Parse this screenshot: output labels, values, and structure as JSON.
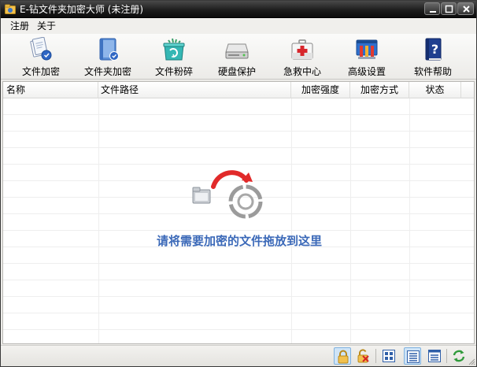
{
  "window": {
    "title": "E-钻文件夹加密大师 (未注册)"
  },
  "menu": {
    "items": [
      {
        "label": "注册"
      },
      {
        "label": "关于"
      }
    ]
  },
  "toolbar": {
    "items": [
      {
        "label": "文件加密",
        "icon": "file-encrypt-icon"
      },
      {
        "label": "文件夹加密",
        "icon": "folder-encrypt-icon"
      },
      {
        "label": "文件粉碎",
        "icon": "file-shred-icon"
      },
      {
        "label": "硬盘保护",
        "icon": "disk-protect-icon"
      },
      {
        "label": "急救中心",
        "icon": "first-aid-icon"
      },
      {
        "label": "高级设置",
        "icon": "advanced-settings-icon"
      },
      {
        "label": "软件帮助",
        "icon": "help-book-icon"
      }
    ]
  },
  "list": {
    "columns": [
      {
        "label": "名称"
      },
      {
        "label": "文件路径"
      },
      {
        "label": "加密强度"
      },
      {
        "label": "加密方式"
      },
      {
        "label": "状态"
      }
    ],
    "empty_hint": "请将需要加密的文件拖放到这里"
  },
  "statusbar": {
    "buttons": [
      {
        "icon": "lock-icon",
        "active": true
      },
      {
        "icon": "unlock-icon",
        "active": false
      },
      {
        "icon": "large-icons-view-icon",
        "active": false
      },
      {
        "icon": "details-view-icon",
        "active": true
      },
      {
        "icon": "list-view-icon",
        "active": false
      },
      {
        "icon": "refresh-icon",
        "active": false
      }
    ]
  },
  "colors": {
    "accent_text": "#3b69b8",
    "titlebar": "#1e1e1e"
  }
}
